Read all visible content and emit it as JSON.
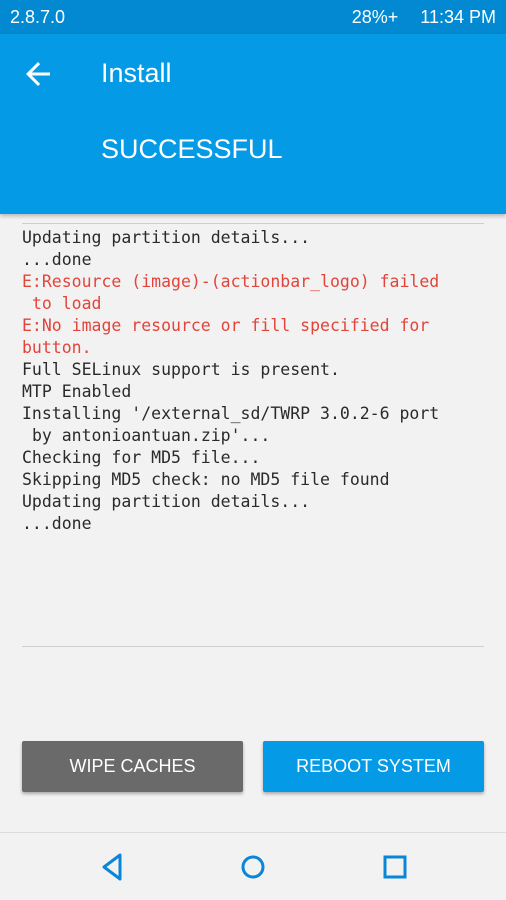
{
  "status_bar": {
    "version": "2.8.7.0",
    "battery": "28%+",
    "time": "11:34 PM"
  },
  "header": {
    "back_icon": "arrow-left-icon",
    "title": "Install",
    "result": "SUCCESSFUL"
  },
  "console": {
    "lines": [
      {
        "text": "Updating partition details...",
        "error": false
      },
      {
        "text": "...done",
        "error": false
      },
      {
        "text": "E:Resource (image)-(actionbar_logo) failed\n to load",
        "error": true
      },
      {
        "text": "E:No image resource or fill specified for\nbutton.",
        "error": true
      },
      {
        "text": "Full SELinux support is present.",
        "error": false
      },
      {
        "text": "MTP Enabled",
        "error": false
      },
      {
        "text": "Installing '/external_sd/TWRP 3.0.2-6 port\n by antonioantuan.zip'...",
        "error": false
      },
      {
        "text": "Checking for MD5 file...",
        "error": false
      },
      {
        "text": "Skipping MD5 check: no MD5 file found",
        "error": false
      },
      {
        "text": "Updating partition details...",
        "error": false
      },
      {
        "text": "...done",
        "error": false
      }
    ]
  },
  "buttons": {
    "wipe": "WIPE CACHES",
    "reboot": "REBOOT SYSTEM"
  },
  "nav": {
    "back_icon": "triangle-back-icon",
    "home_icon": "circle-home-icon",
    "recents_icon": "square-recents-icon"
  },
  "colors": {
    "status_bar": "#0289d1",
    "header": "#049ae6",
    "error_text": "#e3443a",
    "wipe_button": "#6a6a6a",
    "reboot_button": "#049ae6",
    "nav_icons": "#0a86d8"
  }
}
